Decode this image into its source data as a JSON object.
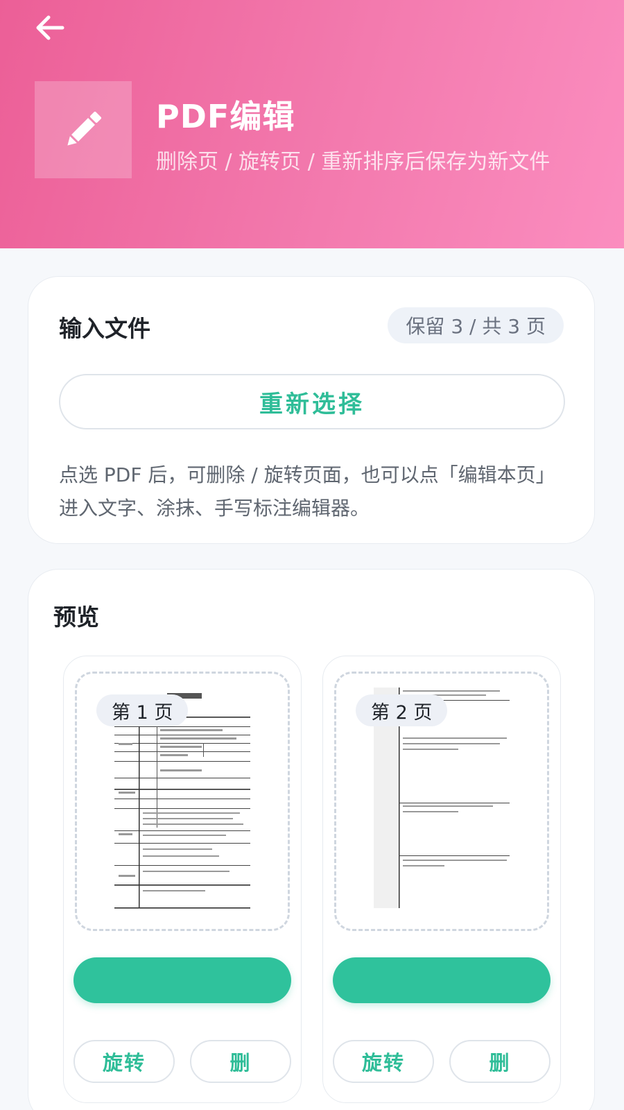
{
  "header": {
    "back_icon": "arrow-left-icon",
    "logo_icon": "pencil-icon",
    "title": "PDF编辑",
    "subtitle": "删除页 / 旋转页 / 重新排序后保存为新文件",
    "colors": {
      "gradient_start": "#ec5f97",
      "gradient_end": "#fb8dbf"
    }
  },
  "input_section": {
    "title": "输入文件",
    "badge": "保留 3 / 共 3 页",
    "reselect_label": "重新选择",
    "hint": "点选 PDF 后，可删除 / 旋转页面，也可以点「编辑本页」进入文字、涂抹、手写标注编辑器。"
  },
  "preview_section": {
    "title": "预览",
    "pages": [
      {
        "label": "第 1 页",
        "edit_label": "",
        "rotate_label": "旋转",
        "delete_label": "删"
      },
      {
        "label": "第 2 页",
        "edit_label": "",
        "rotate_label": "旋转",
        "delete_label": "删"
      }
    ]
  },
  "colors": {
    "accent": "#2fc29c",
    "accent_text": "#2fbd98",
    "background": "#f6f8fb"
  }
}
